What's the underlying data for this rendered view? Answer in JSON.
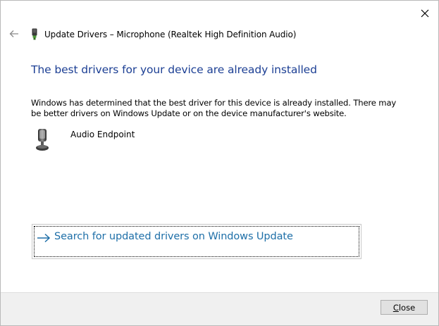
{
  "window": {
    "title": "Update Drivers – Microphone (Realtek High Definition Audio)",
    "close_icon": "close-x-icon",
    "back_icon": "back-arrow-icon",
    "title_icon": "device-manager-icon"
  },
  "content": {
    "heading": "The best drivers for your device are already installed",
    "description": "Windows has determined that the best driver for this device is already installed. There may be better drivers on Windows Update or on the device manufacturer's website.",
    "device": {
      "icon": "microphone-icon",
      "name": "Audio Endpoint"
    },
    "link": {
      "icon": "right-arrow-icon",
      "label": "Search for updated drivers on Windows Update"
    }
  },
  "footer": {
    "close_button": {
      "mnemonic": "C",
      "rest": "lose"
    }
  },
  "colors": {
    "heading": "#1c3f94",
    "link": "#1e6fa8",
    "footer_bg": "#f0f0f0"
  }
}
